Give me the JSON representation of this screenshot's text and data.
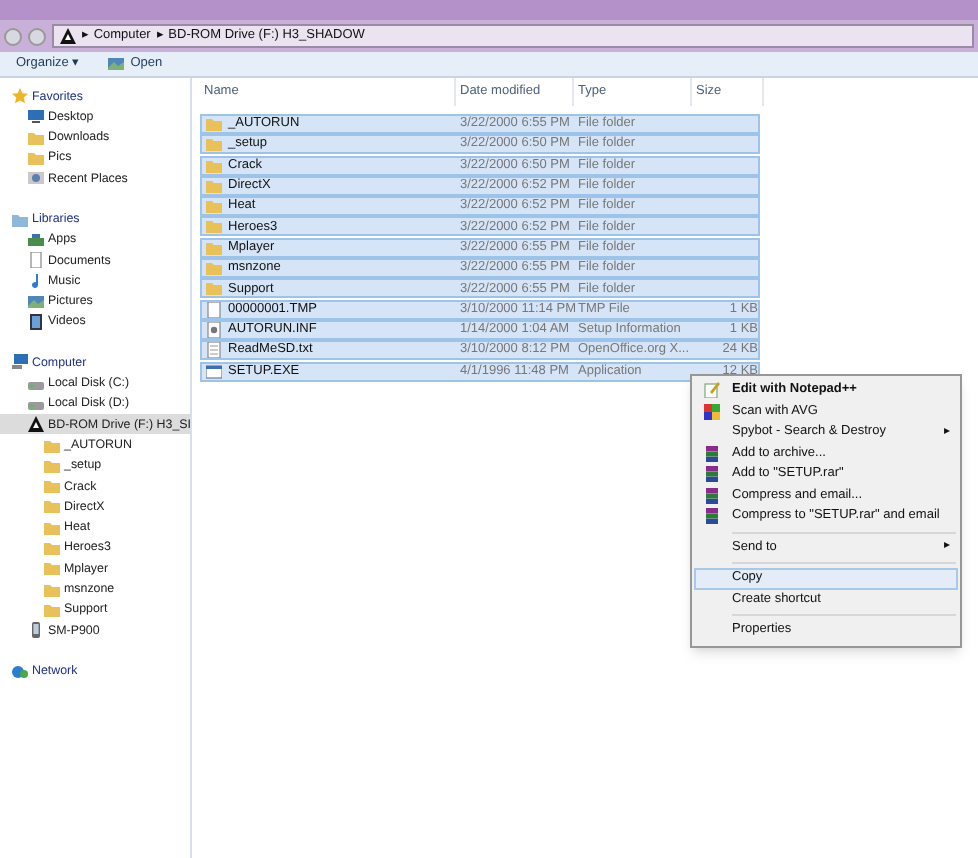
{
  "address_bar": {
    "crumbs": [
      "Computer",
      "BD-ROM Drive (F:) H3_SHADOW"
    ]
  },
  "toolbar": {
    "buttons": [
      "Organize ▾",
      "Open"
    ]
  },
  "sidebar": {
    "groups": [
      {
        "label": "Favorites",
        "kind": "star",
        "children": [
          {
            "label": "Desktop",
            "kind": "desktop",
            "selected": false
          },
          {
            "label": "Downloads",
            "kind": "folder",
            "selected": false
          },
          {
            "label": "Pics",
            "kind": "folder",
            "selected": false
          },
          {
            "label": "Recent Places",
            "kind": "recent",
            "selected": false
          }
        ]
      },
      {
        "label": "Libraries",
        "kind": "library",
        "children": [
          {
            "label": "Apps",
            "kind": "apps",
            "selected": false
          },
          {
            "label": "Documents",
            "kind": "doc",
            "selected": false
          },
          {
            "label": "Music",
            "kind": "music",
            "selected": false
          },
          {
            "label": "Pictures",
            "kind": "pictures",
            "selected": false
          },
          {
            "label": "Videos",
            "kind": "video",
            "selected": false
          }
        ]
      },
      {
        "label": "Computer",
        "kind": "computer",
        "children": [
          {
            "label": "Local Disk (C:)",
            "kind": "disk",
            "selected": false
          },
          {
            "label": "Local Disk (D:)",
            "kind": "disk",
            "selected": false
          },
          {
            "label": "BD-ROM Drive (F:) H3_SI",
            "kind": "cdrom",
            "selected": true,
            "children": [
              {
                "label": "_AUTORUN",
                "kind": "folder",
                "selected": false
              },
              {
                "label": "_setup",
                "kind": "folder",
                "selected": false
              },
              {
                "label": "Crack",
                "kind": "folder",
                "selected": false
              },
              {
                "label": "DirectX",
                "kind": "folder",
                "selected": false
              },
              {
                "label": "Heat",
                "kind": "folder",
                "selected": false
              },
              {
                "label": "Heroes3",
                "kind": "folder",
                "selected": false
              },
              {
                "label": "Mplayer",
                "kind": "folder",
                "selected": false
              },
              {
                "label": "msnzone",
                "kind": "folder",
                "selected": false
              },
              {
                "label": "Support",
                "kind": "folder",
                "selected": false
              }
            ]
          },
          {
            "label": "SM-P900",
            "kind": "device",
            "selected": false
          }
        ]
      },
      {
        "label": "Network",
        "kind": "network"
      }
    ]
  },
  "table": {
    "columns": [
      "Name",
      "Date modified",
      "Type",
      "Size"
    ],
    "rows": [
      {
        "kind": "folder",
        "name": "_AUTORUN",
        "date": "3/22/2000 6:55 PM",
        "type": "File folder",
        "selected": true
      },
      {
        "kind": "folder",
        "name": "_setup",
        "date": "3/22/2000 6:50 PM",
        "type": "File folder",
        "selected": true
      },
      {
        "kind": "folder",
        "name": "Crack",
        "date": "3/22/2000 6:50 PM",
        "type": "File folder",
        "selected": true
      },
      {
        "kind": "folder",
        "name": "DirectX",
        "date": "3/22/2000 6:52 PM",
        "type": "File folder",
        "selected": true
      },
      {
        "kind": "folder",
        "name": "Heat",
        "date": "3/22/2000 6:52 PM",
        "type": "File folder",
        "selected": true
      },
      {
        "kind": "folder",
        "name": "Heroes3",
        "date": "3/22/2000 6:52 PM",
        "type": "File folder",
        "selected": true
      },
      {
        "kind": "folder",
        "name": "Mplayer",
        "date": "3/22/2000 6:55 PM",
        "type": "File folder",
        "selected": true
      },
      {
        "kind": "folder",
        "name": "msnzone",
        "date": "3/22/2000 6:55 PM",
        "type": "File folder",
        "selected": true
      },
      {
        "kind": "folder",
        "name": "Support",
        "date": "3/22/2000 6:55 PM",
        "type": "File folder",
        "selected": true
      },
      {
        "kind": "file",
        "name": "00000001.TMP",
        "date": "3/10/2000 11:14 PM",
        "type": "TMP File",
        "size": "1 KB",
        "selected": true
      },
      {
        "kind": "setup",
        "name": "AUTORUN.INF",
        "date": "1/14/2000 1:04 AM",
        "type": "Setup Information",
        "size": "1 KB",
        "selected": true
      },
      {
        "kind": "text",
        "name": "ReadMeSD.txt",
        "date": "3/10/2000 8:12 PM",
        "type": "OpenOffice.org X...",
        "size": "24 KB",
        "selected": true
      },
      {
        "kind": "app",
        "name": "SETUP.EXE",
        "date": "4/1/1996 11:48 PM",
        "type": "Application",
        "size": "12 KB",
        "selected": true
      }
    ]
  },
  "context_menu": {
    "items": [
      {
        "kind": "notepad",
        "label": "Edit with Notepad++",
        "bold": true,
        "submenu": false,
        "selected": false
      },
      {
        "kind": "avg",
        "label": "Scan with AVG",
        "bold": false,
        "submenu": false,
        "selected": false
      },
      {
        "kind": "plain",
        "label": "Spybot - Search & Destroy",
        "bold": false,
        "submenu": true,
        "selected": false
      },
      {
        "kind": "rar",
        "label": "Add to archive...",
        "bold": false,
        "submenu": false,
        "selected": false
      },
      {
        "kind": "rar",
        "label": "Add to \"SETUP.rar\"",
        "bold": false,
        "submenu": false,
        "selected": false
      },
      {
        "kind": "rar",
        "label": "Compress and email...",
        "bold": false,
        "submenu": false,
        "selected": false
      },
      {
        "kind": "rar",
        "label": "Compress to \"SETUP.rar\" and email",
        "bold": false,
        "submenu": false,
        "selected": false
      },
      {
        "kind": "separator"
      },
      {
        "kind": "plain",
        "label": "Send to",
        "bold": false,
        "submenu": true,
        "selected": false
      },
      {
        "kind": "separator"
      },
      {
        "kind": "plain",
        "label": "Copy",
        "bold": false,
        "submenu": false,
        "selected": true
      },
      {
        "kind": "plain",
        "label": "Create shortcut",
        "bold": false,
        "submenu": false,
        "selected": false
      },
      {
        "kind": "separator"
      },
      {
        "kind": "plain",
        "label": "Properties",
        "bold": false,
        "submenu": false,
        "selected": false
      }
    ]
  },
  "submenu_arrow": "▸"
}
